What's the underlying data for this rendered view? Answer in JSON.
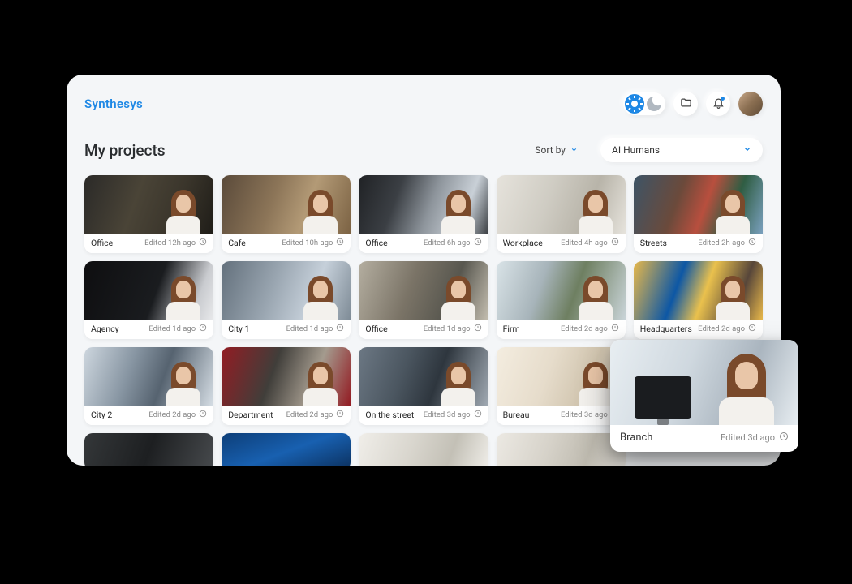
{
  "brand": "Synthesys",
  "page_title": "My projects",
  "sort_label": "Sort by",
  "filter_value": "AI Humans",
  "projects": [
    {
      "name": "Office",
      "edited": "Edited 12h ago",
      "bg": "office"
    },
    {
      "name": "Cafe",
      "edited": "Edited 10h ago",
      "bg": "cafe"
    },
    {
      "name": "Office",
      "edited": "Edited 6h ago",
      "bg": "office2"
    },
    {
      "name": "Workplace",
      "edited": "Edited 4h ago",
      "bg": "work"
    },
    {
      "name": "Streets",
      "edited": "Edited 2h ago",
      "bg": "streets"
    },
    {
      "name": "Agency",
      "edited": "Edited 1d ago",
      "bg": "agency"
    },
    {
      "name": "City 1",
      "edited": "Edited 1d ago",
      "bg": "city1"
    },
    {
      "name": "Office",
      "edited": "Edited 1d ago",
      "bg": "office3"
    },
    {
      "name": "Firm",
      "edited": "Edited 2d ago",
      "bg": "firm"
    },
    {
      "name": "Headquarters",
      "edited": "Edited 2d ago",
      "bg": "hq"
    },
    {
      "name": "City 2",
      "edited": "Edited 2d ago",
      "bg": "city2"
    },
    {
      "name": "Department",
      "edited": "Edited 2d ago",
      "bg": "dept"
    },
    {
      "name": "On the street",
      "edited": "Edited 3d ago",
      "bg": "street2"
    },
    {
      "name": "Bureau",
      "edited": "Edited 3d ago",
      "bg": "bureau"
    },
    {
      "name": "Branch",
      "edited": "Edited 3d ago",
      "bg": "branch"
    },
    {
      "name": "",
      "edited": "",
      "bg": "p16"
    },
    {
      "name": "",
      "edited": "",
      "bg": "p17"
    },
    {
      "name": "",
      "edited": "",
      "bg": "p18"
    },
    {
      "name": "",
      "edited": "",
      "bg": "p19"
    }
  ],
  "preview": {
    "name": "Branch",
    "edited": "Edited 3d ago"
  }
}
